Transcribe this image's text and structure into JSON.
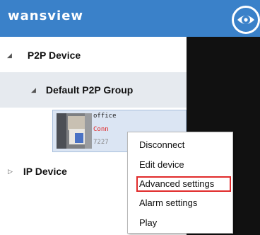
{
  "header": {
    "brand_logo": "wansview"
  },
  "tree": {
    "p2p": {
      "arrow": "◢",
      "label": "P2P Device"
    },
    "group": {
      "arrow": "◢",
      "label": "Default P2P Group"
    },
    "device": {
      "name": "office",
      "status": "Conn",
      "id": "7227"
    },
    "ip": {
      "arrow": "▷",
      "label": "IP Device"
    }
  },
  "context_menu": {
    "items": [
      "Disconnect",
      "Edit device",
      "Advanced settings",
      "Alarm settings",
      "Play"
    ],
    "highlighted": "Advanced settings",
    "highlight_color": "#e12b2b"
  },
  "colors": {
    "header_bg": "#3a81c9",
    "group_bg": "#e6eaef",
    "video_bg": "#111111"
  }
}
